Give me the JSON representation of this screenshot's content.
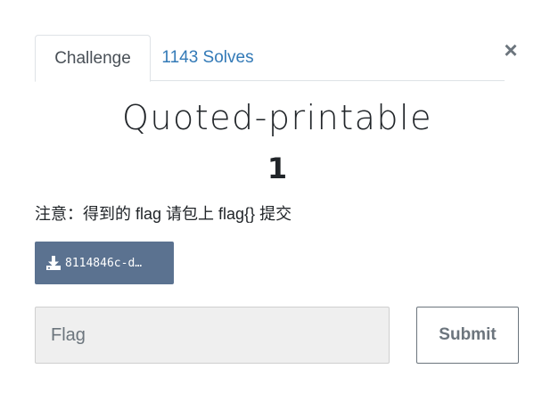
{
  "tabs": {
    "challenge_label": "Challenge",
    "solves_label": "1143 Solves"
  },
  "close_label": "×",
  "challenge": {
    "name": "Quoted-printable",
    "value": "1",
    "description": "注意：得到的 flag 请包上 flag{} 提交"
  },
  "file": {
    "name": "8114846c-d…",
    "icon": "download-icon"
  },
  "flag_input": {
    "placeholder": "Flag"
  },
  "submit_label": "Submit",
  "colors": {
    "file_button_bg": "#5b7290",
    "solves_link": "#337ab7",
    "input_bg": "#efefef"
  }
}
